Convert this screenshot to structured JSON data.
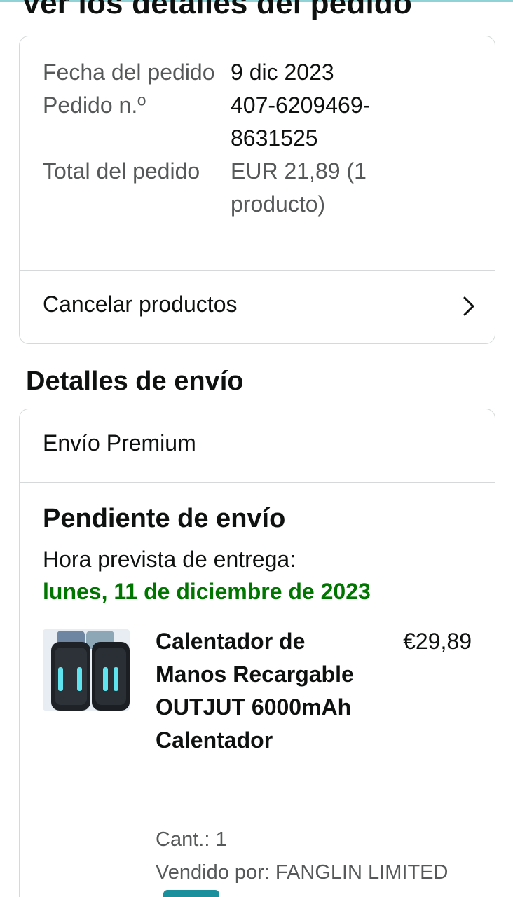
{
  "header": {
    "title": "Ver los detalles del pedido"
  },
  "order_summary": {
    "rows": [
      {
        "label": "Fecha del pedido",
        "value": "9 dic 2023"
      },
      {
        "label": "Pedido n.º",
        "value": "407-6209469-8631525"
      },
      {
        "label": "Total del pedido",
        "value": "EUR 21,89 (1 producto)"
      }
    ],
    "cancel_label": "Cancelar productos",
    "cancel_icon": "chevron-right-icon"
  },
  "shipping": {
    "section_title": "Detalles de envío",
    "method": "Envío Premium",
    "status": "Pendiente de envío",
    "eta_label": "Hora prevista de entrega:",
    "eta_date": "lunes, 11 de diciembre de 2023",
    "eta_color": "#007600"
  },
  "product": {
    "name": "Calentador de Manos Recargable OUTJUT 6000mAh Calentador",
    "price": "€29,89",
    "quantity": "Cant.: 1",
    "seller": "Vendido por: FANGLIN LIMITED",
    "image_icon": "hand-warmer-product-image"
  },
  "theme": {
    "accent": "#1b8f9c",
    "border": "#d5d9d9",
    "muted_text": "#565959"
  }
}
